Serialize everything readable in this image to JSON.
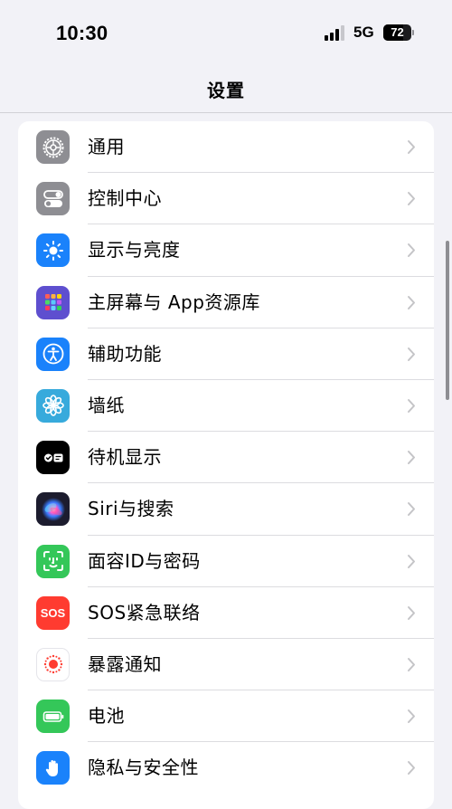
{
  "status_bar": {
    "time": "10:30",
    "network": "5G",
    "battery_percent": "72",
    "battery_level": 0.72,
    "signal_bars_filled": 3,
    "signal_bars_total": 4
  },
  "nav": {
    "title": "设置"
  },
  "settings_items": [
    {
      "label": "通用",
      "icon": "gear-icon",
      "color": "#8e8e93"
    },
    {
      "label": "控制中心",
      "icon": "toggles-icon",
      "color": "#8e8e93"
    },
    {
      "label": "显示与亮度",
      "icon": "sun-icon",
      "color": "#1a82fb"
    },
    {
      "label": "主屏幕与 App资源库",
      "icon": "app-grid-icon",
      "color": "#5e4fcf"
    },
    {
      "label": "辅助功能",
      "icon": "accessibility-icon",
      "color": "#1a82fb"
    },
    {
      "label": "墙纸",
      "icon": "flower-icon",
      "color": "#37aadc"
    },
    {
      "label": "待机显示",
      "icon": "standby-icon",
      "color": "#000000"
    },
    {
      "label": "Siri与搜索",
      "icon": "siri-icon",
      "color": "#1c1c2e"
    },
    {
      "label": "面容ID与密码",
      "icon": "face-id-icon",
      "color": "#34c759"
    },
    {
      "label": "SOS紧急联络",
      "icon": "sos-icon",
      "color": "#ff3b30",
      "icon_text": "SOS"
    },
    {
      "label": "暴露通知",
      "icon": "exposure-icon",
      "color": "#ffffff"
    },
    {
      "label": "电池",
      "icon": "battery-icon",
      "color": "#34c759"
    },
    {
      "label": "隐私与安全性",
      "icon": "hand-icon",
      "color": "#1a82fb"
    }
  ]
}
